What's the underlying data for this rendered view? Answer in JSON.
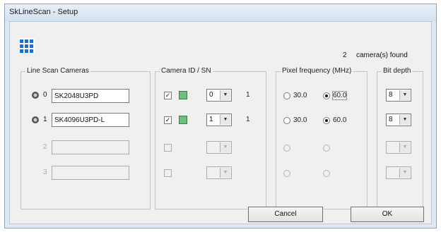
{
  "window": {
    "title": "SkLineScan - Setup"
  },
  "status": {
    "count": "2",
    "label": "camera(s) found"
  },
  "groups": {
    "cameras": "Line Scan Cameras",
    "camera_id": "Camera ID / SN",
    "pixel_freq": "Pixel frequency (MHz)",
    "bit_depth": "Bit depth"
  },
  "rows": [
    {
      "index": "0",
      "name": "SK2048U3PD",
      "checked": true,
      "id": "0",
      "sn": "1",
      "freq_a": "30.0",
      "freq_b": "60.0",
      "bit": "8"
    },
    {
      "index": "1",
      "name": "SK4096U3PD-L",
      "checked": true,
      "id": "1",
      "sn": "1",
      "freq_a": "30.0",
      "freq_b": "60.0",
      "bit": "8"
    },
    {
      "index": "2",
      "name": "",
      "checked": false,
      "id": "",
      "sn": "",
      "freq_a": "",
      "freq_b": "",
      "bit": ""
    },
    {
      "index": "3",
      "name": "",
      "checked": false,
      "id": "",
      "sn": "",
      "freq_a": "",
      "freq_b": "",
      "bit": ""
    }
  ],
  "glyphs": {
    "check": "✓",
    "arrow": "▼"
  },
  "buttons": {
    "cancel": "Cancel",
    "ok": "OK"
  },
  "icons": {
    "app": "grid-app-icon",
    "camera": "camera-icon",
    "camera_id": "camera-id-icon"
  },
  "colors": {
    "app_icon": "#1e6fd0",
    "camera_icon": "#6fbf7f"
  }
}
